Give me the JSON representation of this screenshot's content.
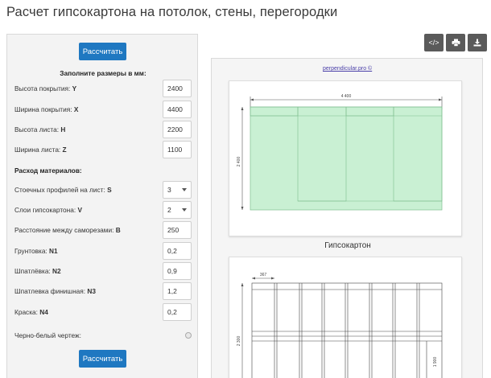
{
  "page": {
    "title": "Расчет гипсокартона на потолок, стены, перегородки"
  },
  "form": {
    "calc_button": "Рассчитать",
    "calc_button_bottom": "Рассчитать",
    "dimensions_heading": "Заполните размеры в мм:",
    "height_cover": {
      "label": "Высота покрытия: ",
      "key": "Y",
      "value": "2400"
    },
    "width_cover": {
      "label": "Ширина покрытия: ",
      "key": "X",
      "value": "4400"
    },
    "sheet_height": {
      "label": "Высота листа: ",
      "key": "H",
      "value": "2200"
    },
    "sheet_width": {
      "label": "Ширина листа: ",
      "key": "Z",
      "value": "1100"
    },
    "materials_heading": "Расход материалов:",
    "rack_profiles": {
      "label": "Стоечных профилей на лист: ",
      "key": "S",
      "value": "3"
    },
    "layers": {
      "label": "Слои гипсокартона: ",
      "key": "V",
      "value": "2"
    },
    "screw_distance": {
      "label": "Расстояние между саморезами: ",
      "key": "B",
      "value": "250"
    },
    "primer": {
      "label": "Грунтовка: ",
      "key": "N1",
      "value": "0,2"
    },
    "putty": {
      "label": "Шпатлёвка: ",
      "key": "N2",
      "value": "0,9"
    },
    "finish_putty": {
      "label": "Шпатлевка финишная: ",
      "key": "N3",
      "value": "1,2"
    },
    "paint": {
      "label": "Краска: ",
      "key": "N4",
      "value": "0,2"
    },
    "bw_drawing": {
      "label": "Черно-белый чертеж:"
    }
  },
  "toolbar": {
    "icons": [
      "code-icon",
      "print-icon",
      "download-icon"
    ],
    "code_glyph": "</>"
  },
  "preview": {
    "source_link": "perpendicular.pro ©",
    "drawing1": {
      "width_label": "4 400",
      "height_label": "2 400",
      "caption": "Гипсокартон"
    },
    "drawing2": {
      "spacing_label": "367",
      "height_label": "2 300",
      "small_label": "1 900"
    }
  },
  "colors": {
    "accent": "#1f78c1",
    "sheet_fill": "#c9f0d3",
    "sheet_stroke": "#7fbf8f",
    "toolbar": "#5a5a5a"
  }
}
